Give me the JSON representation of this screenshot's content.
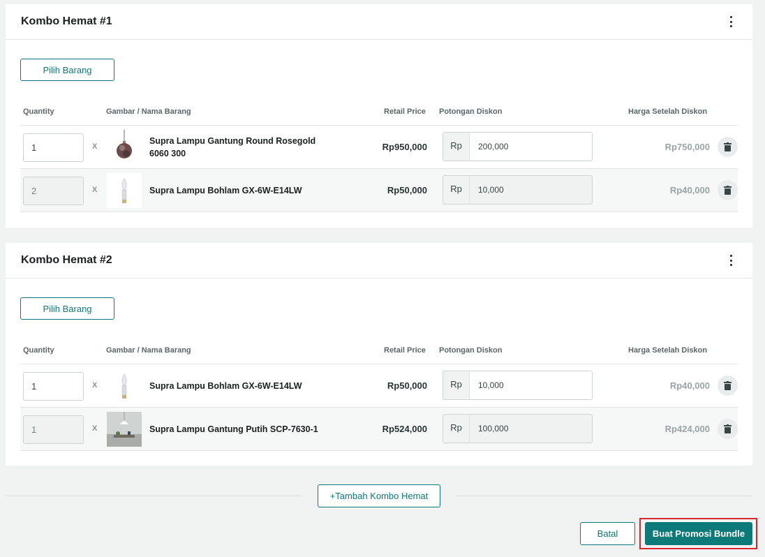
{
  "combos": [
    {
      "title": "Kombo Hemat #1",
      "pick_label": "Pilih Barang",
      "headers": {
        "quantity": "Quantity",
        "product": "Gambar / Nama Barang",
        "retail": "Retail Price",
        "discount": "Potongan Diskon",
        "final": "Harga Setelah Diskon"
      },
      "rows": [
        {
          "qty": "1",
          "times": "X",
          "name": "Supra Lampu Gantung Round Rosegold 6060 300",
          "image": "rosegold-pendant-lamp",
          "retail": "Rp950,000",
          "currency": "Rp",
          "discount": "200,000",
          "final": "Rp750,000"
        },
        {
          "qty": "2",
          "times": "X",
          "name": "Supra Lampu Bohlam GX-6W-E14LW",
          "image": "candle-led-bulb",
          "retail": "Rp50,000",
          "currency": "Rp",
          "discount": "10,000",
          "final": "Rp40,000"
        }
      ]
    },
    {
      "title": "Kombo Hemat #2",
      "pick_label": "Pilih Barang",
      "headers": {
        "quantity": "Quantity",
        "product": "Gambar / Nama Barang",
        "retail": "Retail Price",
        "discount": "Potongan Diskon",
        "final": "Harga Setelah Diskon"
      },
      "rows": [
        {
          "qty": "1",
          "times": "X",
          "name": "Supra Lampu Bohlam GX-6W-E14LW",
          "image": "candle-led-bulb",
          "retail": "Rp50,000",
          "currency": "Rp",
          "discount": "10,000",
          "final": "Rp40,000"
        },
        {
          "qty": "1",
          "times": "X",
          "name": "Supra Lampu Gantung Putih SCP-7630-1",
          "image": "white-pendant-room",
          "retail": "Rp524,000",
          "currency": "Rp",
          "discount": "100,000",
          "final": "Rp424,000"
        }
      ]
    }
  ],
  "footer": {
    "add_combo_label": "+Tambah Kombo Hemat",
    "cancel_label": "Batal",
    "submit_label": "Buat Promosi Bundle"
  },
  "colors": {
    "accent": "#0b7a78",
    "highlight": "#d9262c",
    "background": "#f1f2f2"
  },
  "icons": [
    "kebab-menu-icon",
    "trash-icon"
  ]
}
